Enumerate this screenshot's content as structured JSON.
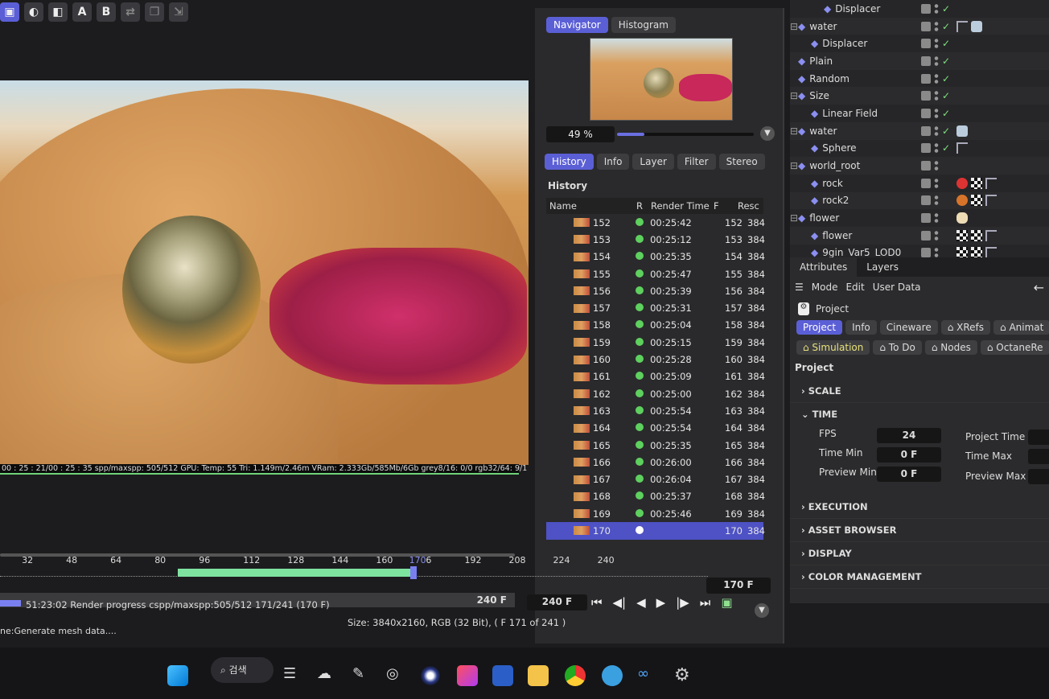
{
  "toolbar": {
    "buttons": [
      {
        "icon": "render-region-icon",
        "label": ""
      },
      {
        "icon": "contrast-icon",
        "label": ""
      },
      {
        "icon": "compare-icon",
        "label": ""
      },
      {
        "icon": "",
        "label": "A"
      },
      {
        "icon": "",
        "label": "B"
      },
      {
        "icon": "swap-icon",
        "label": ""
      },
      {
        "icon": "layer-icon",
        "label": ""
      },
      {
        "icon": "export-icon",
        "label": ""
      }
    ]
  },
  "viewport": {
    "status": "00 : 25 : 21/00 : 25 : 35 spp/maxspp: 505/512 GPU: Temp: 55 Tri: 1.149m/2.46m VRam: 2.333Gb/585Mb/6Gb grey8/16: 0/0 rgb32/64: 9/1"
  },
  "navigator": {
    "tabs": [
      "Navigator",
      "Histogram"
    ],
    "zoom": "49 %",
    "zoom_fraction": 0.2
  },
  "history": {
    "tabs": [
      "History",
      "Info",
      "Layer",
      "Filter",
      "Stereo"
    ],
    "title": "History",
    "columns": [
      "Name",
      "R",
      "Render Time",
      "F",
      "Resc"
    ],
    "rows": [
      {
        "name": "152",
        "time": "00:25:42",
        "f": "152",
        "res": "384"
      },
      {
        "name": "153",
        "time": "00:25:12",
        "f": "153",
        "res": "384"
      },
      {
        "name": "154",
        "time": "00:25:35",
        "f": "154",
        "res": "384"
      },
      {
        "name": "155",
        "time": "00:25:47",
        "f": "155",
        "res": "384"
      },
      {
        "name": "156",
        "time": "00:25:39",
        "f": "156",
        "res": "384"
      },
      {
        "name": "157",
        "time": "00:25:31",
        "f": "157",
        "res": "384"
      },
      {
        "name": "158",
        "time": "00:25:04",
        "f": "158",
        "res": "384"
      },
      {
        "name": "159",
        "time": "00:25:15",
        "f": "159",
        "res": "384"
      },
      {
        "name": "160",
        "time": "00:25:28",
        "f": "160",
        "res": "384"
      },
      {
        "name": "161",
        "time": "00:25:09",
        "f": "161",
        "res": "384"
      },
      {
        "name": "162",
        "time": "00:25:00",
        "f": "162",
        "res": "384"
      },
      {
        "name": "163",
        "time": "00:25:54",
        "f": "163",
        "res": "384"
      },
      {
        "name": "164",
        "time": "00:25:54",
        "f": "164",
        "res": "384"
      },
      {
        "name": "165",
        "time": "00:25:35",
        "f": "165",
        "res": "384"
      },
      {
        "name": "166",
        "time": "00:26:00",
        "f": "166",
        "res": "384"
      },
      {
        "name": "167",
        "time": "00:26:04",
        "f": "167",
        "res": "384"
      },
      {
        "name": "168",
        "time": "00:25:37",
        "f": "168",
        "res": "384"
      },
      {
        "name": "169",
        "time": "00:25:46",
        "f": "169",
        "res": "384"
      },
      {
        "name": "170",
        "time": "",
        "f": "170",
        "res": "384",
        "selected": true
      }
    ]
  },
  "outliner": {
    "items": [
      {
        "name": "Displacer",
        "indent": 2,
        "icon": "displacer-icon",
        "check": true
      },
      {
        "name": "water",
        "indent": 0,
        "icon": "plane-icon",
        "check": true,
        "expand": true,
        "tags": [
          "phong",
          "material-water"
        ]
      },
      {
        "name": "Displacer",
        "indent": 1,
        "icon": "displacer-icon",
        "check": true
      },
      {
        "name": "Plain",
        "indent": 0,
        "icon": "effector-icon",
        "check": true
      },
      {
        "name": "Random",
        "indent": 0,
        "icon": "random-icon",
        "check": true
      },
      {
        "name": "Size",
        "indent": 0,
        "icon": "effector-icon",
        "check": true,
        "expand": true
      },
      {
        "name": "Linear Field",
        "indent": 1,
        "icon": "field-icon",
        "check": true
      },
      {
        "name": "water",
        "indent": 0,
        "icon": "emitter-icon",
        "check": true,
        "expand": true,
        "tags": [
          "material-water"
        ]
      },
      {
        "name": "Sphere",
        "indent": 1,
        "icon": "sphere-icon",
        "check": true,
        "tags": [
          "phong"
        ]
      },
      {
        "name": "world_root",
        "indent": 0,
        "icon": "null-icon",
        "check": false,
        "expand": true
      },
      {
        "name": "rock",
        "indent": 1,
        "icon": "polygon-icon",
        "check": false,
        "tags": [
          "material-red",
          "uv",
          "phong"
        ]
      },
      {
        "name": "rock2",
        "indent": 1,
        "icon": "polygon-icon",
        "check": false,
        "tags": [
          "material-orange",
          "uv",
          "phong"
        ]
      },
      {
        "name": "flower",
        "indent": 0,
        "icon": "null-icon",
        "check": false,
        "expand": true,
        "tags": [
          "material-cream"
        ]
      },
      {
        "name": "flower",
        "indent": 1,
        "icon": "polygon-icon",
        "check": false,
        "tags": [
          "uv",
          "uv",
          "phong"
        ]
      },
      {
        "name": "9gin_Var5_LOD0",
        "indent": 1,
        "icon": "polygon-icon",
        "check": false,
        "tags": [
          "uv",
          "uv",
          "phong"
        ]
      }
    ]
  },
  "attributes": {
    "tabs": [
      "Attributes",
      "Layers"
    ],
    "menu": [
      "Mode",
      "Edit",
      "User Data"
    ],
    "object": "Project",
    "chips_row1": [
      "Project",
      "Info",
      "Cineware",
      "⌂ XRefs",
      "⌂ Animat"
    ],
    "chips_row2": [
      "⌂ Simulation",
      "⌂ To Do",
      "⌂ Nodes",
      "⌂ OctaneRe"
    ],
    "section_title": "Project",
    "sections": {
      "scale": "SCALE",
      "time": "TIME",
      "execution": "EXECUTION",
      "asset": "ASSET BROWSER",
      "display": "DISPLAY",
      "color": "COLOR MANAGEMENT"
    },
    "fields": {
      "fps_label": "FPS",
      "fps": "24",
      "tmin_label": "Time Min",
      "tmin": "0 F",
      "pmin_label": "Preview Min",
      "pmin": "0 F",
      "ptime_label": "Project Time",
      "tmax_label": "Time Max",
      "pmax_label": "Preview Max"
    }
  },
  "timeline": {
    "ticks": [
      "32",
      "48",
      "64",
      "80",
      "96",
      "112",
      "128",
      "144",
      "160",
      "170",
      "6",
      "192",
      "208",
      "224",
      "240"
    ],
    "current_frame": "170 F",
    "end_frame": "240 F",
    "end_frame2": "240 F",
    "rendered_range": [
      86,
      170
    ]
  },
  "status": {
    "progress_text": "51:23:02 Render progress  cspp/maxspp:505/512 171/241 (170 F)",
    "size_text": "Size: 3840x2160, RGB (32 Bit),  ( F 171 of 241 )",
    "bottom": "ne:Generate mesh data...."
  },
  "taskbar": {
    "search": "검색"
  }
}
